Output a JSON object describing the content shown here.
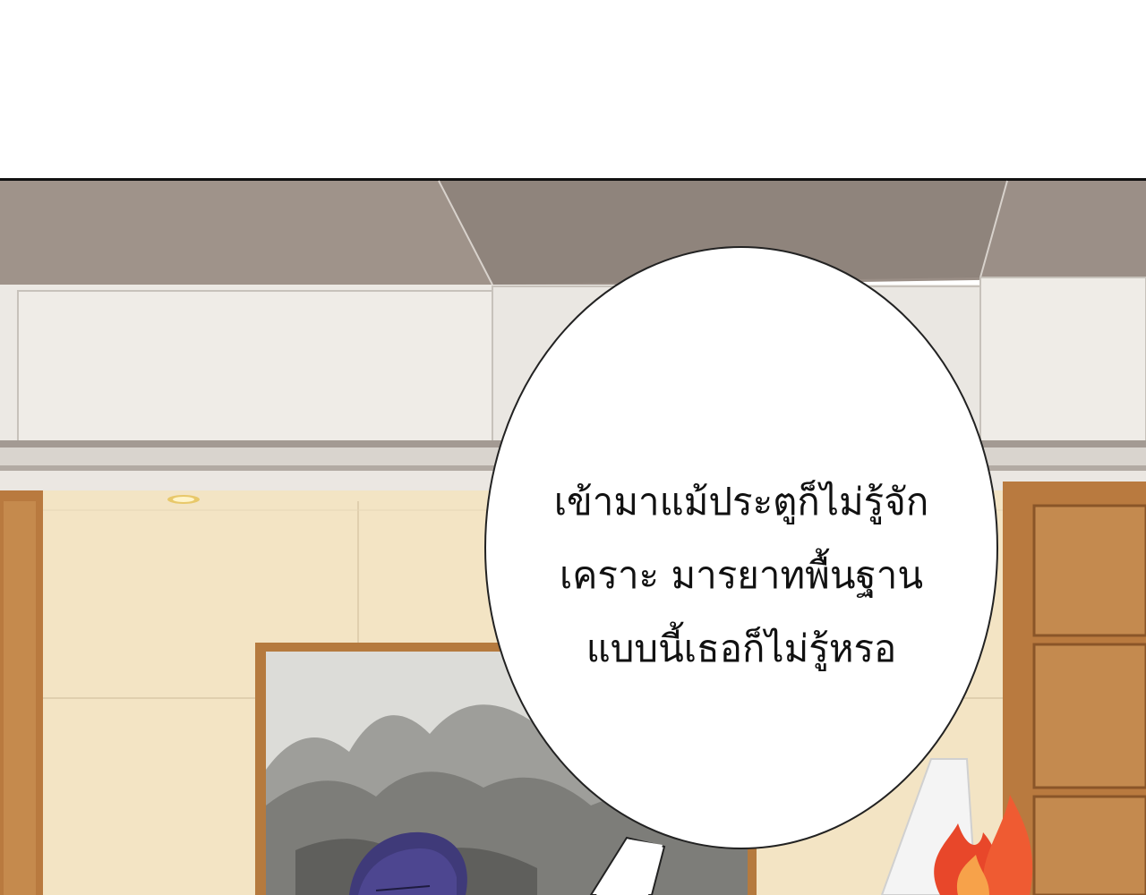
{
  "colors": {
    "ceiling_top": "#9a8e86",
    "wall_panel": "#ece9e4",
    "wall_beige": "#f3e4c4",
    "wood": "#b97a3f",
    "bubble": "#ffffff",
    "hair": "#3f3a79",
    "fire": "#e8472a"
  },
  "panel": {
    "speech_bubble": {
      "lines": [
        "เข้ามาแม้ประตูก็ไม่รู้จัก",
        "เคราะ มารยาทพื้นฐาน",
        "แบบนี้เธอก็ไม่รู้หรอ"
      ]
    },
    "icons": {
      "fire": "fire-icon"
    }
  }
}
